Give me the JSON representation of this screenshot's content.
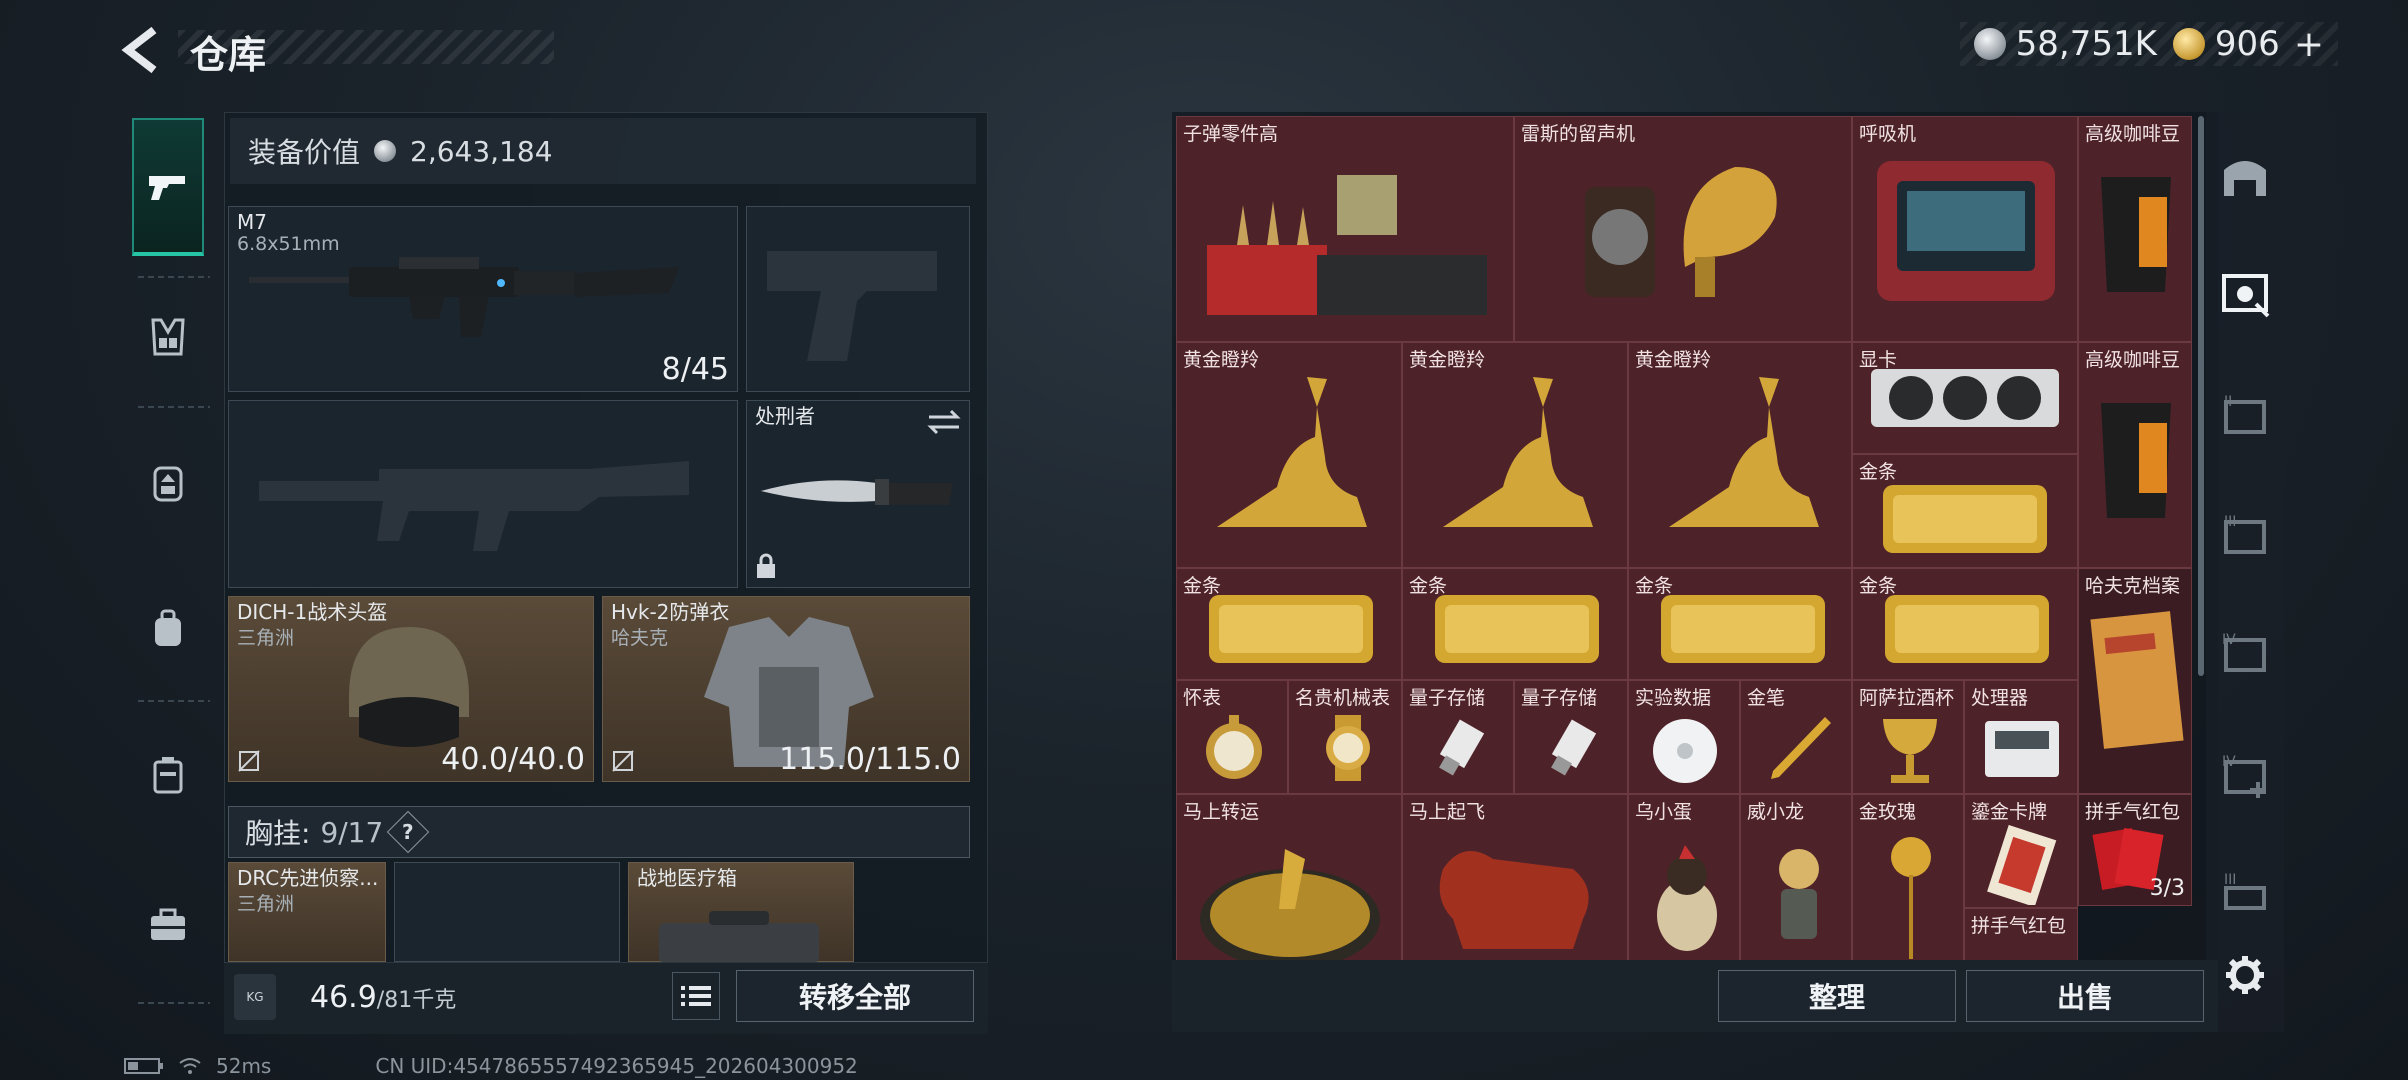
{
  "header": {
    "title": "仓库",
    "back_label": "back"
  },
  "currency": {
    "silver": "58,751K",
    "gold": "906",
    "add": "+"
  },
  "left_nav": {
    "items": [
      "weapon",
      "vest",
      "backpack-rig",
      "backpack",
      "case",
      "toolbox"
    ]
  },
  "equipment": {
    "value_label": "装备价值",
    "value": "2,643,184",
    "primary": {
      "name": "M7",
      "caliber": "6.8x51mm",
      "ammo": "8/45"
    },
    "melee": {
      "name": "处刑者"
    },
    "helmet": {
      "name": "DICH-1战术头盔",
      "maker": "三角洲",
      "durability": "40.0/40.0"
    },
    "armor": {
      "name": "Hvk-2防弹衣",
      "maker": "哈夫克",
      "durability": "115.0/115.0"
    },
    "chest_label": "胸挂:",
    "chest_value": "9/17",
    "help": "?",
    "rig_item": {
      "name": "DRC先进侦察...",
      "maker": "三角洲"
    },
    "med_item": {
      "name": "战地医疗箱"
    }
  },
  "footer": {
    "weight": "46.9",
    "weight_max": "/81千克",
    "transfer_all": "转移全部",
    "kg": "KG"
  },
  "stash": {
    "items": [
      "子弹零件高",
      "雷斯的留声机",
      "呼吸机",
      "高级咖啡豆",
      "黄金瞪羚",
      "黄金瞪羚",
      "黄金瞪羚",
      "显卡",
      "高级咖啡豆",
      "金条",
      "金条",
      "金条",
      "金条",
      "金条",
      "哈夫克档案",
      "怀表",
      "名贵机械表",
      "量子存储",
      "量子存储",
      "实验数据",
      "金笔",
      "阿萨拉酒杯",
      "处理器",
      "马上转运",
      "马上起飞",
      "乌小蛋",
      "威小龙",
      "金玫瑰",
      "鎏金卡牌",
      "拼手气红包",
      "拼手气红包"
    ],
    "red_packet_count": "3/3"
  },
  "actions": {
    "sort": "整理",
    "sell": "出售"
  },
  "status": {
    "ping": "52ms",
    "uid": "CN UID:4547865557492365945_202604300952"
  }
}
